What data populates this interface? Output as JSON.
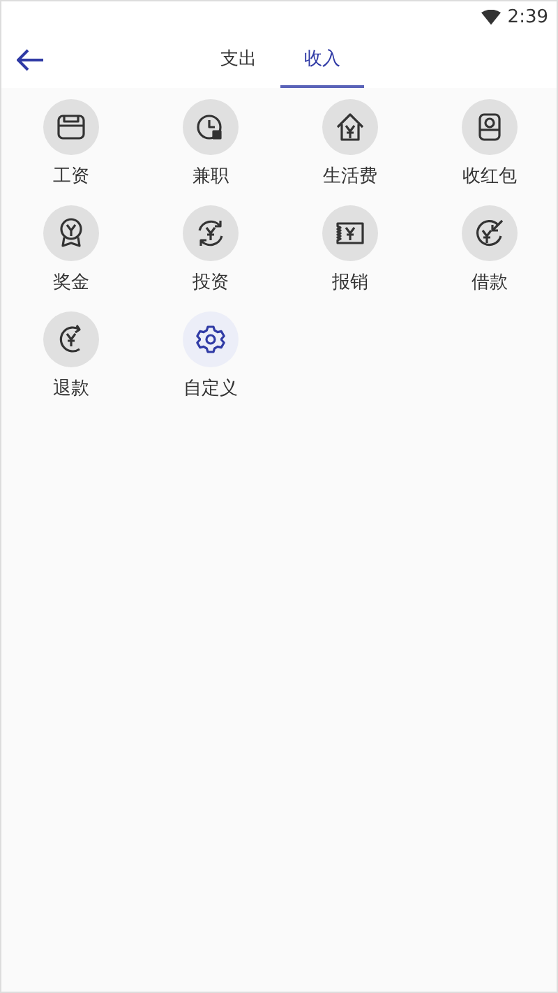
{
  "status_bar": {
    "time": "2:39"
  },
  "tabs": [
    {
      "label": "支出",
      "selected": false
    },
    {
      "label": "收入",
      "selected": true
    }
  ],
  "categories": [
    {
      "label": "工资",
      "kind": "wallet"
    },
    {
      "label": "兼职",
      "kind": "clock"
    },
    {
      "label": "生活费",
      "kind": "house"
    },
    {
      "label": "收红包",
      "kind": "packet"
    },
    {
      "label": "奖金",
      "kind": "medal"
    },
    {
      "label": "投资",
      "kind": "cycle"
    },
    {
      "label": "报销",
      "kind": "ticket"
    },
    {
      "label": "借款",
      "kind": "borrow"
    },
    {
      "label": "退款",
      "kind": "refund"
    },
    {
      "label": "自定义",
      "kind": "custom"
    }
  ]
}
